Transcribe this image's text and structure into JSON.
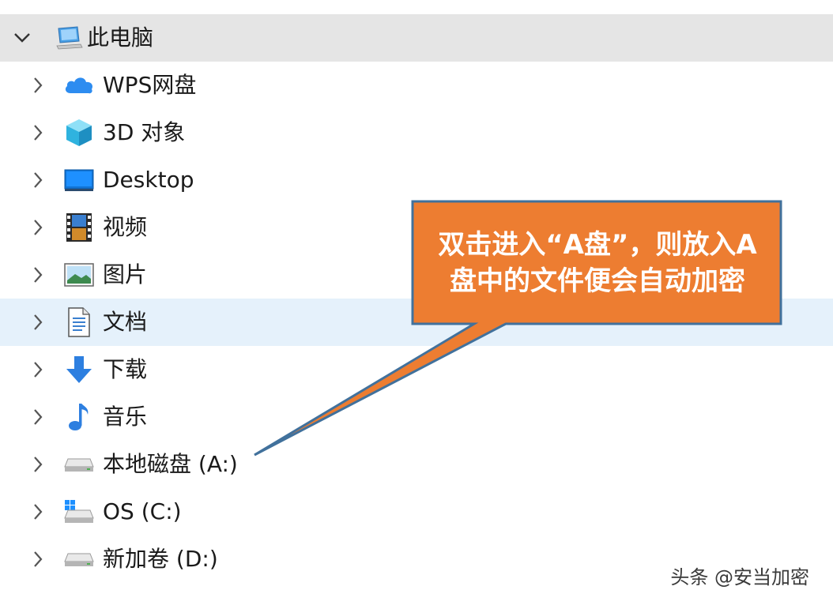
{
  "tree": {
    "root": {
      "label": "此电脑",
      "icon": "computer-icon",
      "expanded": true
    },
    "items": [
      {
        "label": "WPS网盘",
        "icon": "cloud-icon"
      },
      {
        "label": "3D 对象",
        "icon": "cube-3d-icon"
      },
      {
        "label": "Desktop",
        "icon": "desktop-icon"
      },
      {
        "label": "视频",
        "icon": "video-film-icon"
      },
      {
        "label": "图片",
        "icon": "picture-icon"
      },
      {
        "label": "文档",
        "icon": "document-icon",
        "highlighted": true
      },
      {
        "label": "下载",
        "icon": "download-arrow-icon"
      },
      {
        "label": "音乐",
        "icon": "music-note-icon"
      },
      {
        "label": "本地磁盘 (A:)",
        "icon": "drive-icon"
      },
      {
        "label": "OS (C:)",
        "icon": "windows-drive-icon"
      },
      {
        "label": "新加卷 (D:)",
        "icon": "drive-icon"
      }
    ]
  },
  "callout": {
    "text": "双击进入“A盘”，则放入A盘中的文件便会自动加密",
    "fill_color": "#ed7d31",
    "border_color": "#41719c"
  },
  "watermark": {
    "text": "头条 @安当加密"
  },
  "colors": {
    "header_band": "#e5e5e5",
    "highlight_row": "#e5f1fb"
  }
}
